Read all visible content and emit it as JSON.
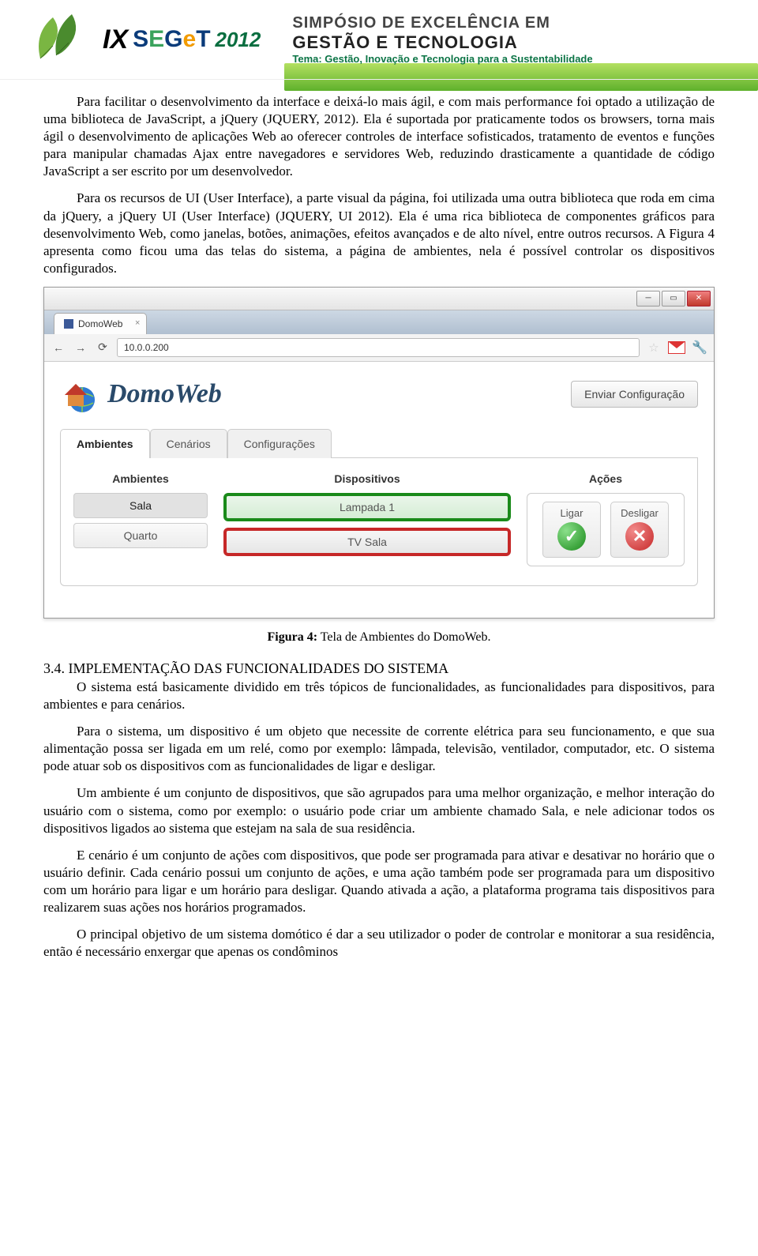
{
  "header": {
    "ix": "IX",
    "seget": "SEGeT",
    "year": "2012",
    "line1": "SIMPÓSIO DE EXCELÊNCIA EM",
    "line2": "GESTÃO E TECNOLOGIA",
    "line3": "Tema: Gestão, Inovação e Tecnologia para a Sustentabilidade"
  },
  "paragraphs": {
    "p1": "Para facilitar o desenvolvimento da interface e deixá-lo mais ágil, e com mais performance foi optado a utilização de uma biblioteca de JavaScript, a jQuery (JQUERY, 2012). Ela é suportada por praticamente todos os browsers, torna mais ágil o desenvolvimento de aplicações Web ao oferecer controles de interface sofisticados, tratamento de eventos e funções para manipular chamadas Ajax entre navegadores e servidores Web, reduzindo drasticamente a quantidade de código JavaScript a ser escrito por um desenvolvedor.",
    "p2": "Para os recursos de UI (User Interface), a parte visual da página, foi utilizada uma outra biblioteca que roda em cima da jQuery, a jQuery UI (User Interface) (JQUERY, UI 2012). Ela é uma rica biblioteca de componentes gráficos para desenvolvimento Web, como janelas, botões, animações, efeitos avançados e de alto nível, entre outros recursos. A Figura 4 apresenta como ficou uma das telas do sistema, a página de ambientes, nela é possível controlar os dispositivos configurados.",
    "fig_caption_bold": "Figura 4:",
    "fig_caption_rest": " Tela de Ambientes do DomoWeb.",
    "section": "3.4. IMPLEMENTAÇÃO DAS FUNCIONALIDADES DO SISTEMA",
    "p3": "O sistema está basicamente dividido em três tópicos de funcionalidades, as funcionalidades para dispositivos, para ambientes e para cenários.",
    "p4": "Para o sistema, um dispositivo é um objeto que necessite de corrente elétrica para seu funcionamento, e que sua alimentação possa ser ligada em um relé, como por exemplo: lâmpada, televisão, ventilador, computador, etc. O sistema pode atuar sob os dispositivos com as funcionalidades de ligar e desligar.",
    "p5": "Um ambiente é um conjunto de dispositivos, que são agrupados para uma melhor organização, e melhor interação do usuário com o sistema, como por exemplo: o usuário pode criar um ambiente chamado Sala, e nele adicionar todos os dispositivos ligados ao sistema que estejam na sala de sua residência.",
    "p6": "E cenário é um conjunto de ações com dispositivos, que pode ser programada para ativar e desativar no horário que o usuário definir. Cada cenário possui um conjunto de ações, e uma ação também pode ser programada para um dispositivo com um horário para ligar e um horário para desligar. Quando ativada a ação, a plataforma programa tais dispositivos para realizarem suas ações nos horários programados.",
    "p7": "O principal objetivo de um sistema domótico é dar a seu utilizador o poder de controlar e monitorar a sua residência, então é necessário enxergar que apenas os condôminos"
  },
  "browser": {
    "tab_title": "DomoWeb",
    "url": "10.0.0.200",
    "app_name": "DomoWeb",
    "send_config": "Enviar Configuração",
    "tabs": [
      "Ambientes",
      "Cenários",
      "Configurações"
    ],
    "columns": {
      "ambientes": "Ambientes",
      "dispositivos": "Dispositivos",
      "acoes": "Ações"
    },
    "ambientes": [
      "Sala",
      "Quarto"
    ],
    "dispositivos": [
      {
        "name": "Lampada 1",
        "state": "on"
      },
      {
        "name": "TV Sala",
        "state": "off"
      }
    ],
    "actions": {
      "ligar": "Ligar",
      "desligar": "Desligar"
    }
  }
}
